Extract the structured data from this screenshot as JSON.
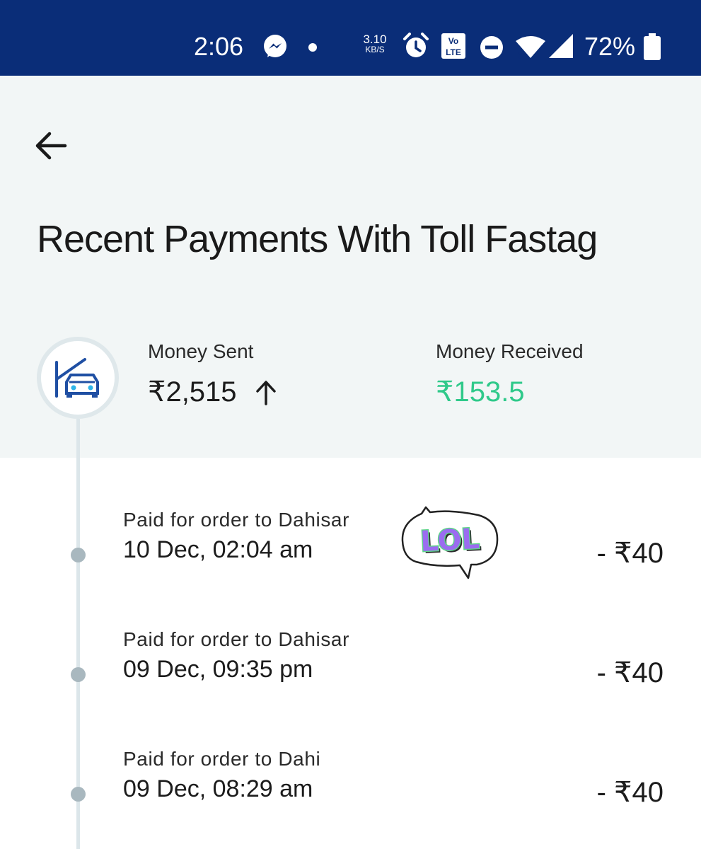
{
  "status_bar": {
    "time": "2:06",
    "net_speed_value": "3.10",
    "net_speed_unit": "KB/S",
    "volte_line1": "Vo",
    "volte_line2": "LTE",
    "battery": "72%",
    "icons": [
      "messenger-icon",
      "notification-dot-icon",
      "alarm-icon",
      "volte-icon",
      "do-not-disturb-icon",
      "wifi-icon",
      "cell-signal-icon",
      "battery-icon"
    ],
    "color": "#0a2d78"
  },
  "header": {
    "title": "Recent Payments With Toll Fastag",
    "icon": "toll-car-icon",
    "money_sent_label": "Money Sent",
    "money_sent_amount": "₹2,515",
    "money_received_label": "Money Received",
    "money_received_amount": "₹153.5",
    "received_color": "#2fc98a"
  },
  "transactions": [
    {
      "description": "Paid for order to Dahisar",
      "date": "10 Dec, 02:04 am",
      "amount": "- ₹40"
    },
    {
      "description": "Paid for order to Dahisar",
      "date": "09 Dec, 09:35 pm",
      "amount": "- ₹40"
    },
    {
      "description": "Paid for order to Dahi",
      "date": "09 Dec, 08:29 am",
      "amount": "- ₹40"
    }
  ],
  "sticker": {
    "text": "LOL"
  }
}
